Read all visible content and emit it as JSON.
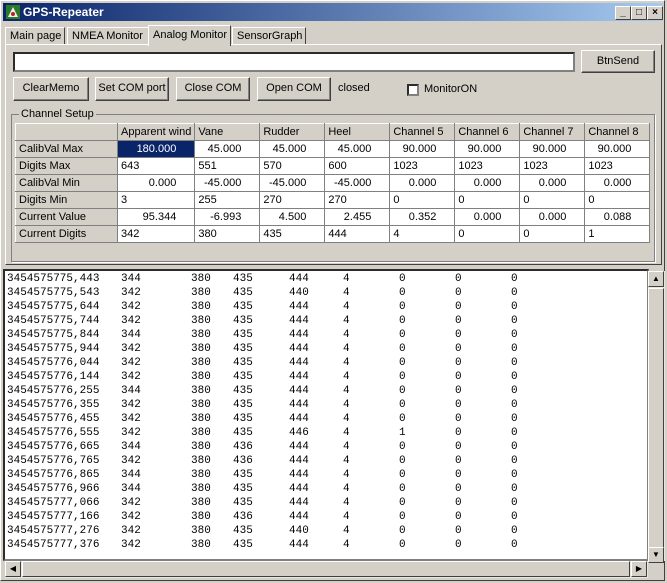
{
  "window": {
    "title": "GPS-Repeater"
  },
  "tabs": [
    "Main page",
    "NMEA Monitor",
    "Analog Monitor",
    "SensorGraph"
  ],
  "send": {
    "value": "",
    "button": "BtnSend"
  },
  "toolbar": {
    "clear_memo": "ClearMemo",
    "set_com_port": "Set COM port",
    "close_com": "Close COM",
    "open_com": "Open COM",
    "status": "closed",
    "monitor_label": "MonitorON",
    "monitor_checked": false
  },
  "channel_setup": {
    "label": "Channel Setup",
    "columns": [
      "Apparent wind",
      "Vane",
      "Rudder",
      "Heel",
      "Channel 5",
      "Channel 6",
      "Channel 7",
      "Channel 8"
    ],
    "rows": [
      {
        "name": "CalibVal Max",
        "values": [
          "180.000",
          "45.000",
          "45.000",
          "45.000",
          "90.000",
          "90.000",
          "90.000",
          "90.000"
        ]
      },
      {
        "name": "Digits Max",
        "values": [
          "643",
          "551",
          "570",
          "600",
          "1023",
          "1023",
          "1023",
          "1023"
        ]
      },
      {
        "name": "CalibVal Min",
        "values": [
          "0.000",
          "-45.000",
          "-45.000",
          "-45.000",
          "0.000",
          "0.000",
          "0.000",
          "0.000"
        ]
      },
      {
        "name": "Digits Min",
        "values": [
          "3",
          "255",
          "270",
          "270",
          "0",
          "0",
          "0",
          "0"
        ]
      },
      {
        "name": "Current Value",
        "values": [
          "95.344",
          "-6.993",
          "4.500",
          "2.455",
          "0.352",
          "0.000",
          "0.000",
          "0.088"
        ]
      },
      {
        "name": "Current Digits",
        "values": [
          "342",
          "380",
          "435",
          "444",
          "4",
          "0",
          "0",
          "1"
        ]
      }
    ]
  },
  "memo_lines": [
    [
      "3454575775,443",
      "344",
      "380",
      "435",
      "444",
      "4",
      "0",
      "0",
      "0"
    ],
    [
      "3454575775,543",
      "342",
      "380",
      "435",
      "440",
      "4",
      "0",
      "0",
      "0"
    ],
    [
      "3454575775,644",
      "342",
      "380",
      "435",
      "444",
      "4",
      "0",
      "0",
      "0"
    ],
    [
      "3454575775,744",
      "342",
      "380",
      "435",
      "444",
      "4",
      "0",
      "0",
      "0"
    ],
    [
      "3454575775,844",
      "344",
      "380",
      "435",
      "444",
      "4",
      "0",
      "0",
      "0"
    ],
    [
      "3454575775,944",
      "342",
      "380",
      "435",
      "444",
      "4",
      "0",
      "0",
      "0"
    ],
    [
      "3454575776,044",
      "342",
      "380",
      "435",
      "444",
      "4",
      "0",
      "0",
      "0"
    ],
    [
      "3454575776,144",
      "342",
      "380",
      "435",
      "444",
      "4",
      "0",
      "0",
      "0"
    ],
    [
      "3454575776,255",
      "344",
      "380",
      "435",
      "444",
      "4",
      "0",
      "0",
      "0"
    ],
    [
      "3454575776,355",
      "342",
      "380",
      "435",
      "444",
      "4",
      "0",
      "0",
      "0"
    ],
    [
      "3454575776,455",
      "342",
      "380",
      "435",
      "444",
      "4",
      "0",
      "0",
      "0"
    ],
    [
      "3454575776,555",
      "342",
      "380",
      "435",
      "446",
      "4",
      "1",
      "0",
      "0"
    ],
    [
      "3454575776,665",
      "344",
      "380",
      "436",
      "444",
      "4",
      "0",
      "0",
      "0"
    ],
    [
      "3454575776,765",
      "342",
      "380",
      "436",
      "444",
      "4",
      "0",
      "0",
      "0"
    ],
    [
      "3454575776,865",
      "344",
      "380",
      "435",
      "444",
      "4",
      "0",
      "0",
      "0"
    ],
    [
      "3454575776,966",
      "344",
      "380",
      "435",
      "444",
      "4",
      "0",
      "0",
      "0"
    ],
    [
      "3454575777,066",
      "342",
      "380",
      "435",
      "444",
      "4",
      "0",
      "0",
      "0"
    ],
    [
      "3454575777,166",
      "342",
      "380",
      "436",
      "444",
      "4",
      "0",
      "0",
      "0"
    ],
    [
      "3454575777,276",
      "342",
      "380",
      "435",
      "440",
      "4",
      "0",
      "0",
      "0"
    ],
    [
      "3454575777,376",
      "342",
      "380",
      "435",
      "444",
      "4",
      "0",
      "0",
      "0"
    ]
  ],
  "icons": {
    "app": "satellite-app-icon",
    "minimize": "minimize-icon",
    "maximize": "maximize-icon",
    "close": "close-icon"
  },
  "colors": {
    "titlebar": "#0a246a",
    "selection": "#0a246a",
    "face": "#d4d0c8"
  }
}
